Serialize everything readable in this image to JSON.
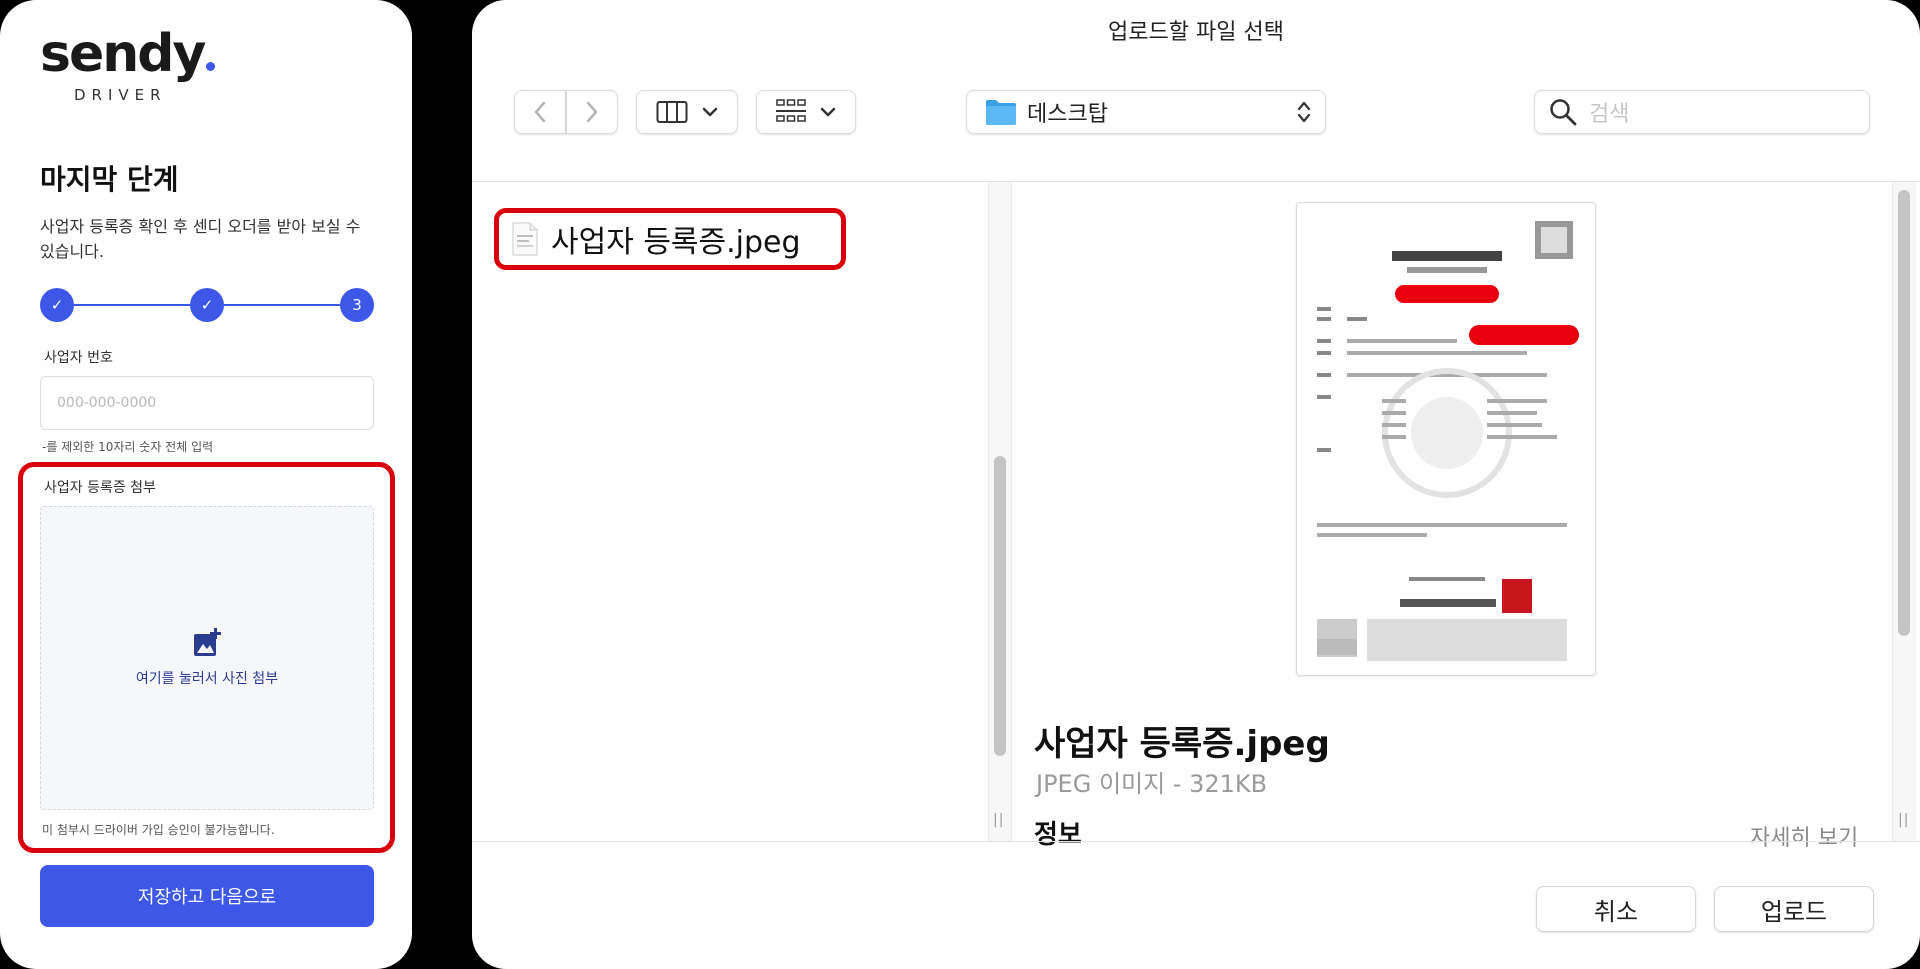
{
  "sendy": {
    "logo": "sendy",
    "logo_sub": "DRIVER",
    "step_title": "마지막 단계",
    "step_desc": "사업자 등록증 확인 후 센디 오더를 받아 보실 수 있습니다.",
    "stepper": {
      "steps": [
        "✓",
        "✓",
        "3"
      ]
    },
    "biz_number": {
      "label": "사업자 번호",
      "placeholder": "000-000-0000",
      "value": "",
      "helper": "-를 제외한 10자리 숫자 전체 입력"
    },
    "attachment": {
      "label": "사업자 등록증 첨부",
      "dropzone_text": "여기를 눌러서 사진 첨부",
      "icon": "add-photo-icon",
      "note": "미 첨부시 드라이버 가입 승인이 불가능합니다."
    },
    "save_button": "저장하고 다음으로",
    "colors": {
      "primary": "#3d57e8",
      "highlight": "#d8000c"
    }
  },
  "dialog": {
    "title": "업로드할 파일 선택",
    "location": "데스크탑",
    "search_placeholder": "검색",
    "files": [
      {
        "name": "사업자 등록증.jpeg",
        "selected": true
      }
    ],
    "preview": {
      "name": "사업자 등록증.jpeg",
      "meta": "JPEG 이미지 - 321KB",
      "info_label": "정보",
      "more_label": "자세히 보기"
    },
    "cancel_button": "취소",
    "upload_button": "업로드"
  }
}
